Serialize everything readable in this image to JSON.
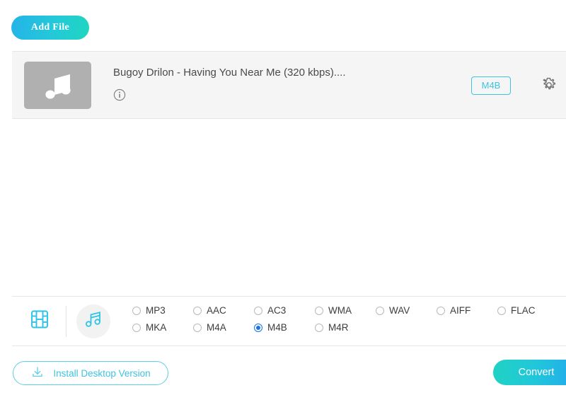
{
  "toolbar": {
    "add_file_label": "Add File"
  },
  "file_row": {
    "thumbnail_icon": "music-note-icon",
    "title": "Bugoy Drilon - Having You Near Me (320 kbps)....",
    "info_icon": "info-icon",
    "format_badge": "M4B",
    "settings_icon": "gear-icon"
  },
  "format_bar": {
    "video_tab_icon": "film-strip-icon",
    "audio_tab_icon": "music-note-icon",
    "selected_format": "M4B",
    "options": [
      {
        "label": "MP3",
        "selected": false
      },
      {
        "label": "AAC",
        "selected": false
      },
      {
        "label": "AC3",
        "selected": false
      },
      {
        "label": "WMA",
        "selected": false
      },
      {
        "label": "WAV",
        "selected": false
      },
      {
        "label": "AIFF",
        "selected": false
      },
      {
        "label": "FLAC",
        "selected": false
      },
      {
        "label": "MKA",
        "selected": false
      },
      {
        "label": "M4A",
        "selected": false
      },
      {
        "label": "M4B",
        "selected": true
      },
      {
        "label": "M4R",
        "selected": false
      }
    ]
  },
  "bottom_bar": {
    "install_label": "Install Desktop Version",
    "install_icon": "download-icon",
    "convert_label": "Convert"
  },
  "colors": {
    "accent_cyan": "#3fc3e0",
    "radio_selected_blue": "#1a73e8",
    "panel_bg": "#f5f5f5",
    "thumb_gray": "#b0b0b0"
  }
}
